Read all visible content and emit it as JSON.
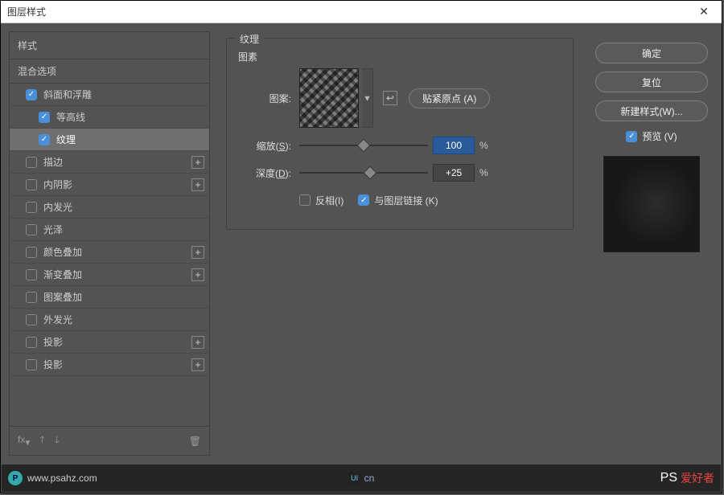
{
  "dialog": {
    "title": "图层样式",
    "close": "✕"
  },
  "left": {
    "header": "样式",
    "blending": "混合选项",
    "items": [
      {
        "label": "斜面和浮雕",
        "checked": true,
        "indent": 1,
        "selected": false,
        "plus": false
      },
      {
        "label": "等高线",
        "checked": true,
        "indent": 2,
        "selected": false,
        "plus": false
      },
      {
        "label": "纹理",
        "checked": true,
        "indent": 2,
        "selected": true,
        "plus": false
      },
      {
        "label": "描边",
        "checked": false,
        "indent": 1,
        "selected": false,
        "plus": true
      },
      {
        "label": "内阴影",
        "checked": false,
        "indent": 1,
        "selected": false,
        "plus": true
      },
      {
        "label": "内发光",
        "checked": false,
        "indent": 1,
        "selected": false,
        "plus": false
      },
      {
        "label": "光泽",
        "checked": false,
        "indent": 1,
        "selected": false,
        "plus": false
      },
      {
        "label": "颜色叠加",
        "checked": false,
        "indent": 1,
        "selected": false,
        "plus": true
      },
      {
        "label": "渐变叠加",
        "checked": false,
        "indent": 1,
        "selected": false,
        "plus": true
      },
      {
        "label": "图案叠加",
        "checked": false,
        "indent": 1,
        "selected": false,
        "plus": false
      },
      {
        "label": "外发光",
        "checked": false,
        "indent": 1,
        "selected": false,
        "plus": false
      },
      {
        "label": "投影",
        "checked": false,
        "indent": 1,
        "selected": false,
        "plus": true
      },
      {
        "label": "投影",
        "checked": false,
        "indent": 1,
        "selected": false,
        "plus": true
      }
    ],
    "footer": {
      "fx": "fx",
      "trash_title": "删除"
    }
  },
  "center": {
    "group_title": "纹理",
    "elements_label": "图素",
    "pattern_label": "图案:",
    "snap_btn": "贴紧原点 (A)",
    "scale_label_pre": "缩放(",
    "scale_key": "S",
    "scale_label_post": "):",
    "scale_value": "100",
    "depth_label_pre": "深度(",
    "depth_key": "D",
    "depth_label_post": "):",
    "depth_value": "+25",
    "percent": "%",
    "invert_label": "反相(I)",
    "link_label": "与图层链接 (K)",
    "link_checked": true,
    "invert_checked": false
  },
  "right": {
    "ok": "确定",
    "reset": "复位",
    "new_style": "新建样式(W)...",
    "preview_label": "预览 (V)"
  },
  "watermark": {
    "left_text": "www.psahz.com",
    "center_text": "cn",
    "right_text": "爱好者"
  }
}
